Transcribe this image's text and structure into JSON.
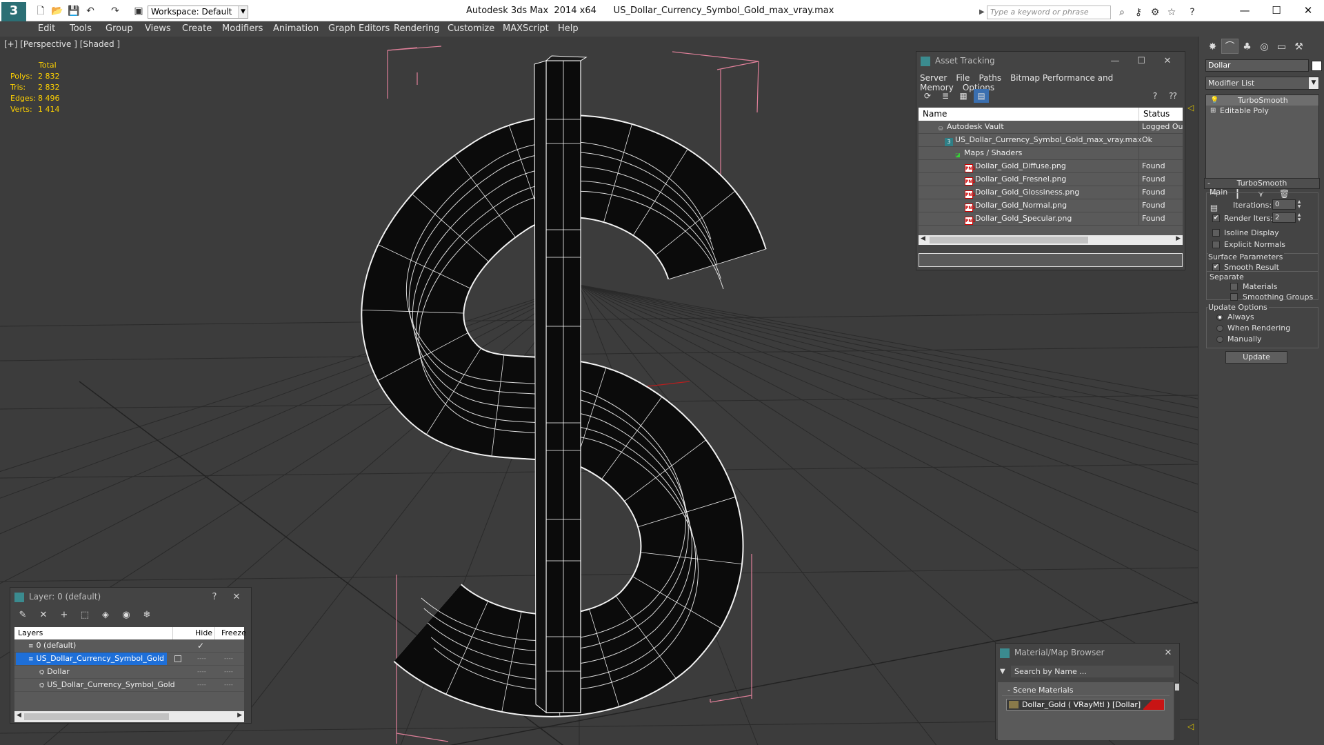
{
  "titlebar": {
    "app_logo": "3",
    "workspace": "Workspace: Default",
    "title": "Autodesk 3ds Max  2014 x64      US_Dollar_Currency_Symbol_Gold_max_vray.max",
    "search_placeholder": "Type a keyword or phrase",
    "minimize": "—",
    "maximize": "☐",
    "close": "✕"
  },
  "menu": [
    "Edit",
    "Tools",
    "Group",
    "Views",
    "Create",
    "Modifiers",
    "Animation",
    "Graph Editors",
    "Rendering",
    "Customize",
    "MAXScript",
    "Help"
  ],
  "viewport": {
    "label": "[+] [Perspective ] [Shaded ]",
    "stats": {
      "header": "Total",
      "rows": [
        {
          "label": "Polys:",
          "value": "2 832"
        },
        {
          "label": "Tris:",
          "value": "2 832"
        },
        {
          "label": "Edges:",
          "value": "8 496"
        },
        {
          "label": "Verts:",
          "value": "1 414"
        }
      ]
    },
    "bg_color": "#3c3c3c",
    "grid_color": "#2a2a2a",
    "bbox_color": "#e0809a",
    "mesh_fill": "#0b0b0b",
    "wire_color": "#ffffff"
  },
  "asset_tracking": {
    "title": "Asset Tracking",
    "menu": [
      "Server",
      "File",
      "Paths",
      "Bitmap Performance and Memory",
      "Options"
    ],
    "columns": {
      "name": "Name",
      "status": "Status"
    },
    "rows": [
      {
        "name": "Autodesk Vault",
        "status": "Logged Ou",
        "indent": 0,
        "icon": "vault-icon"
      },
      {
        "name": "US_Dollar_Currency_Symbol_Gold_max_vray.max",
        "status": "Ok",
        "indent": 1,
        "icon": "max-file-icon"
      },
      {
        "name": "Maps / Shaders",
        "status": "",
        "indent": 2,
        "icon": "maps-folder-icon"
      },
      {
        "name": "Dollar_Gold_Diffuse.png",
        "status": "Found",
        "indent": 3,
        "icon": "png-file-icon"
      },
      {
        "name": "Dollar_Gold_Fresnel.png",
        "status": "Found",
        "indent": 3,
        "icon": "png-file-icon"
      },
      {
        "name": "Dollar_Gold_Glossiness.png",
        "status": "Found",
        "indent": 3,
        "icon": "png-file-icon"
      },
      {
        "name": "Dollar_Gold_Normal.png",
        "status": "Found",
        "indent": 3,
        "icon": "png-file-icon"
      },
      {
        "name": "Dollar_Gold_Specular.png",
        "status": "Found",
        "indent": 3,
        "icon": "png-file-icon"
      }
    ],
    "png_badge": "PNG"
  },
  "command_panel": {
    "object_name": "Dollar",
    "modifier_list": "Modifier List",
    "stack": [
      "TurboSmooth",
      "Editable Poly"
    ],
    "turbosmooth": {
      "title": "TurboSmooth",
      "main_label": "Main",
      "iterations_label": "Iterations:",
      "iterations_value": "0",
      "render_iters_label": "Render Iters:",
      "render_iters_value": "2",
      "render_iters_checked": true,
      "isoline_label": "Isoline Display",
      "isoline_checked": false,
      "explicit_normals_label": "Explicit Normals",
      "explicit_normals_checked": false,
      "surface_label": "Surface Parameters",
      "smooth_result_label": "Smooth Result",
      "smooth_result_checked": true,
      "separate_label": "Separate",
      "materials_label": "Materials",
      "materials_checked": false,
      "smoothing_groups_label": "Smoothing Groups",
      "smoothing_groups_checked": false,
      "update_options_label": "Update Options",
      "update_options": [
        "Always",
        "When Rendering",
        "Manually"
      ],
      "update_selected": "Always",
      "update_button": "Update"
    }
  },
  "layer_window": {
    "title": "Layer: 0 (default)",
    "help": "?",
    "close": "✕",
    "columns": {
      "layers": "Layers",
      "hide": "Hide",
      "freeze": "Freeze"
    },
    "rows": [
      {
        "name": "0 (default)",
        "indent": 1,
        "selected": false,
        "hide": "✓",
        "freeze": ""
      },
      {
        "name": "US_Dollar_Currency_Symbol_Gold",
        "indent": 1,
        "selected": true,
        "hide": "----",
        "freeze": "----"
      },
      {
        "name": "Dollar",
        "indent": 2,
        "selected": false,
        "hide": "----",
        "freeze": "----"
      },
      {
        "name": "US_Dollar_Currency_Symbol_Gold",
        "indent": 2,
        "selected": false,
        "hide": "----",
        "freeze": "----"
      }
    ]
  },
  "material_browser": {
    "title": "Material/Map Browser",
    "close": "✕",
    "search_placeholder": "Search by Name ...",
    "group": "Scene Materials",
    "item": "Dollar_Gold  ( VRayMtl ) [Dollar]"
  }
}
